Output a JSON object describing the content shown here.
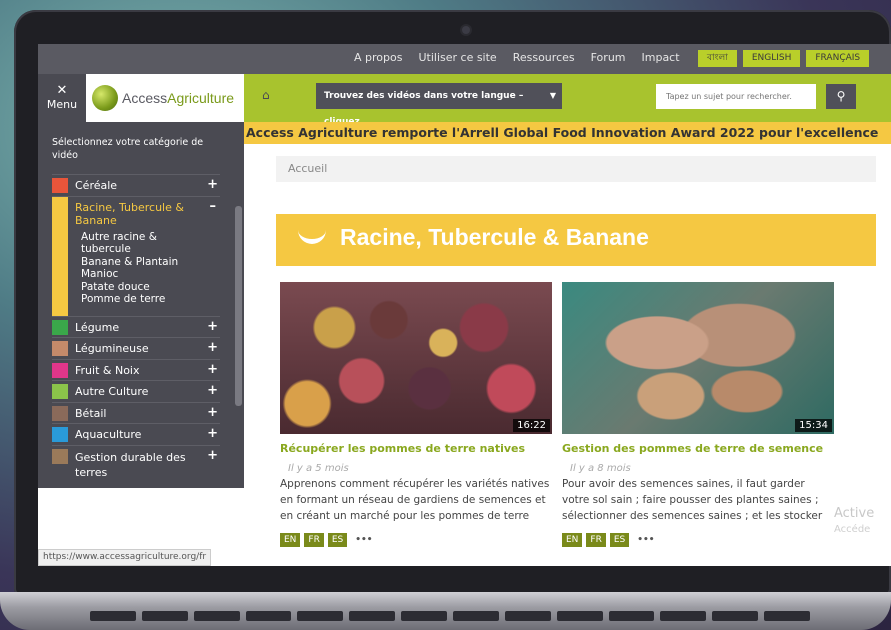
{
  "topnav": [
    "A propos",
    "Utiliser ce site",
    "Ressources",
    "Forum",
    "Impact"
  ],
  "languages": [
    "বাংলা",
    "ENGLISH",
    "FRANÇAIS"
  ],
  "menu_label": "Menu",
  "logo": {
    "part1": "Access",
    "part2": "Agriculture"
  },
  "lang_select": "Trouvez des vidéos dans votre langue – cliquez ...",
  "search": {
    "placeholder": "Tapez un sujet pour rechercher."
  },
  "banner_text": "Access Agriculture remporte l'Arrell Global Food Innovation Award 2022 pour l'excellence",
  "breadcrumb": "Accueil",
  "sidebar": {
    "title": "Sélectionnez votre catégorie de vidéo",
    "categories": [
      {
        "label": "Céréale",
        "color": "#e8553a"
      },
      {
        "label": "Racine, Tubercule & Banane",
        "color": "#f5c842"
      },
      {
        "label": "Légume",
        "color": "#3aa84a"
      },
      {
        "label": "Légumineuse",
        "color": "#c48a6a"
      },
      {
        "label": "Fruit & Noix",
        "color": "#e0368a"
      },
      {
        "label": "Autre Culture",
        "color": "#8bc34a"
      },
      {
        "label": "Bétail",
        "color": "#8a6a5a"
      },
      {
        "label": "Aquaculture",
        "color": "#2a9ad8"
      },
      {
        "label": "Gestion durable des terres",
        "color": "#9a7a5a"
      }
    ],
    "subcategories": [
      "Autre racine &",
      "tubercule",
      "Banane & Plantain",
      "Manioc",
      "Patate douce",
      "Pomme de terre"
    ]
  },
  "category_title": "Racine, Tubercule & Banane",
  "videos": [
    {
      "title": "Récupérer les pommes de terre natives",
      "date": "Il y a 5 mois",
      "desc": "Apprenons comment récupérer les variétés natives en formant un réseau de gardiens de semences et en créant un marché pour les pommes de terre",
      "duration": "16:22",
      "tags": [
        "EN",
        "FR",
        "ES"
      ]
    },
    {
      "title": "Gestion des pommes de terre de semence",
      "date": "Il y a 8 mois",
      "desc": "Pour avoir des semences saines, il faut garder votre sol sain ; faire pousser des plantes saines ; sélectionner des semences saines ; et les stocker",
      "duration": "15:34",
      "tags": [
        "EN",
        "FR",
        "ES"
      ]
    }
  ],
  "more_label": "•••",
  "watermark": {
    "line1": "Active",
    "line2": "Accéde"
  },
  "status_url": "https://www.accessagriculture.org/fr"
}
